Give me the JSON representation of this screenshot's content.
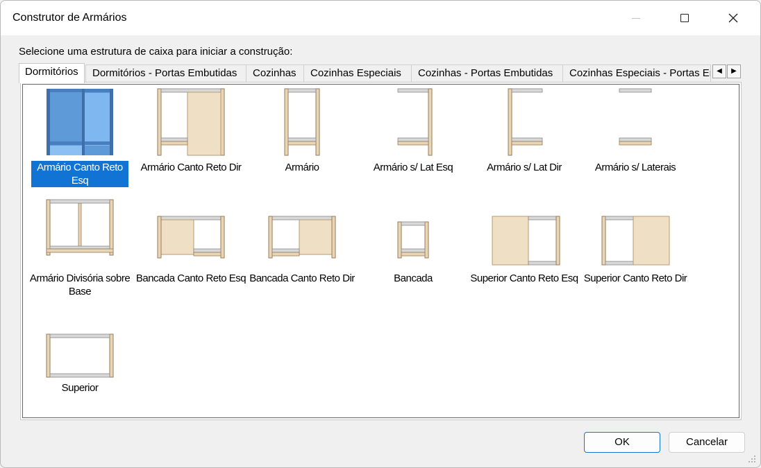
{
  "window": {
    "title": "Construtor de Armários",
    "minimize_icon": "minimize-icon",
    "maximize_icon": "maximize-icon",
    "close_icon": "close-icon"
  },
  "prompt": "Selecione uma estrutura de caixa para iniciar a construção:",
  "tabs": [
    {
      "label": "Dormitórios",
      "active": true
    },
    {
      "label": "Dormitórios - Portas Embutidas"
    },
    {
      "label": "Cozinhas"
    },
    {
      "label": "Cozinhas Especiais"
    },
    {
      "label": "Cozinhas - Portas Embutidas"
    },
    {
      "label": "Cozinhas Especiais - Portas Embutidas"
    }
  ],
  "tab_scroll": {
    "left_icon": "scroll-left-icon",
    "right_icon": "scroll-right-icon"
  },
  "items": [
    {
      "label": "Armário Canto Reto Esq",
      "selected": true,
      "icon": "corner-cabinet-left-icon"
    },
    {
      "label": "Armário Canto Reto Dir",
      "icon": "corner-cabinet-right-icon"
    },
    {
      "label": "Armário",
      "icon": "cabinet-icon"
    },
    {
      "label": "Armário s/ Lat Esq",
      "icon": "cabinet-no-left-side-icon"
    },
    {
      "label": "Armário s/ Lat Dir",
      "icon": "cabinet-no-right-side-icon"
    },
    {
      "label": "Armário s/ Laterais",
      "icon": "cabinet-no-sides-icon"
    },
    {
      "label": "Armário Divisória sobre Base",
      "icon": "divider-cabinet-icon"
    },
    {
      "label": "Bancada Canto Reto Esq",
      "icon": "counter-corner-left-icon"
    },
    {
      "label": "Bancada Canto Reto Dir",
      "icon": "counter-corner-right-icon"
    },
    {
      "label": "Bancada",
      "icon": "counter-icon"
    },
    {
      "label": "Superior Canto Reto Esq",
      "icon": "upper-corner-left-icon"
    },
    {
      "label": "Superior Canto Reto Dir",
      "icon": "upper-corner-right-icon"
    },
    {
      "label": "Superior",
      "icon": "upper-cabinet-icon"
    }
  ],
  "buttons": {
    "ok": "OK",
    "cancel": "Cancelar"
  },
  "colors": {
    "selection": "#1173d4",
    "wood": "#e8d6b8",
    "wood_edge": "#9a7a55",
    "shelf": "#d8d8d8"
  }
}
